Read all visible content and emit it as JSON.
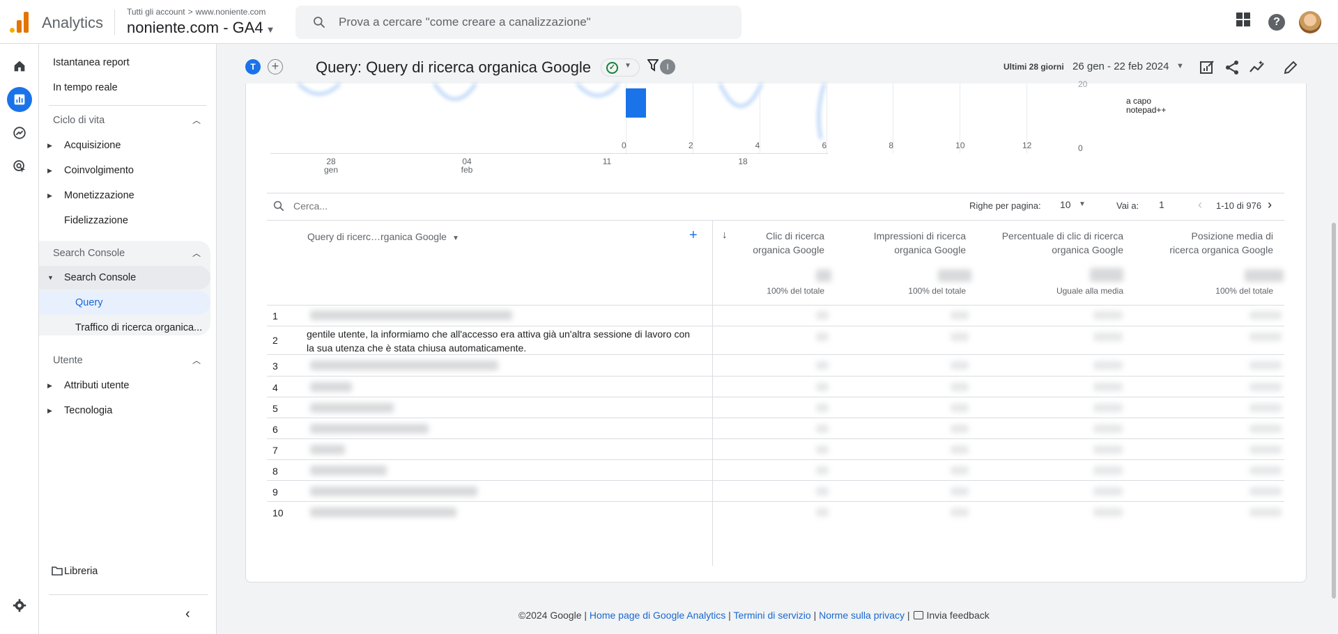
{
  "app": {
    "name": "Analytics",
    "breadcrumb_account": "Tutti gli account",
    "breadcrumb_property": "www.noniente.com",
    "property_name": "noniente.com - GA4"
  },
  "search": {
    "placeholder": "Prova a cercare \"come creare a canalizzazione\""
  },
  "sidebar": {
    "top_items": [
      "Istantanea report",
      "In tempo reale"
    ],
    "lifecycle": {
      "title": "Ciclo di vita",
      "items": [
        "Acquisizione",
        "Coinvolgimento",
        "Monetizzazione",
        "Fidelizzazione"
      ]
    },
    "search_console": {
      "title": "Search Console",
      "parent": "Search Console",
      "children": [
        "Query",
        "Traffico di ricerca organica..."
      ]
    },
    "user": {
      "title": "Utente",
      "items": [
        "Attributi utente",
        "Tecnologia"
      ]
    },
    "library": "Libreria"
  },
  "report": {
    "comparison_chip": "T",
    "title": "Query: Query di ricerca organica Google",
    "filter_badge": "I",
    "date_label": "Ultimi 28 giorni",
    "date_range": "26 gen - 22 feb 2024"
  },
  "line_chart": {
    "x_ticks": [
      {
        "day": "28",
        "month": "gen"
      },
      {
        "day": "04",
        "month": "feb"
      },
      {
        "day": "11",
        "month": ""
      },
      {
        "day": "18",
        "month": ""
      }
    ]
  },
  "bar_chart": {
    "y_ticks": [
      "20",
      "0"
    ],
    "category_label_line1": "a capo",
    "category_label_line2": "notepad++",
    "x_ticks": [
      "0",
      "2",
      "4",
      "6",
      "8",
      "10",
      "12"
    ],
    "bar_value": 1,
    "x_max": 12,
    "bar_color": "#1a73e8"
  },
  "table": {
    "search_placeholder": "Cerca...",
    "rows_per_page_label": "Righe per pagina:",
    "rows_per_page": "10",
    "goto_label": "Vai a:",
    "goto_value": "1",
    "page_range": "1-10 di 976",
    "dimension_header": "Query di ricerc…rganica Google",
    "metrics": [
      {
        "line1": "Clic di ricerca",
        "line2": "organica Google",
        "sub": "100% del totale"
      },
      {
        "line1": "Impressioni di ricerca",
        "line2": "organica Google",
        "sub": "100% del totale"
      },
      {
        "line1": "Percentuale di clic di ricerca",
        "line2": "organica Google",
        "sub": "Uguale alla media"
      },
      {
        "line1": "Posizione media di",
        "line2": "ricerca organica Google",
        "sub": "100% del totale"
      }
    ],
    "row_numbers": [
      "1",
      "2",
      "3",
      "4",
      "5",
      "6",
      "7",
      "8",
      "9",
      "10"
    ],
    "row2_text": "gentile utente, la informiamo che all'accesso era attiva già un'altra sessione di lavoro con la sua utenza che è stata chiusa automaticamente."
  },
  "footer": {
    "copyright": "©2024 Google",
    "link_home": "Home page di Google Analytics",
    "link_terms": "Termini di servizio",
    "link_privacy": "Norme sulla privacy",
    "feedback": "Invia feedback"
  }
}
